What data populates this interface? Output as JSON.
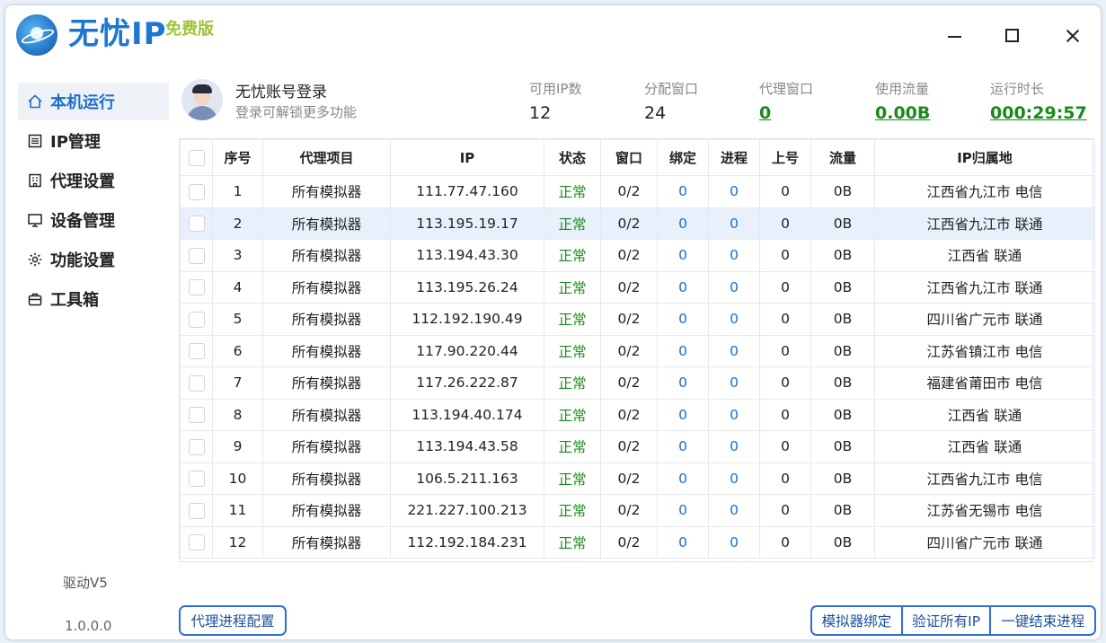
{
  "app": {
    "title": "无忧IP",
    "edition": "免费版"
  },
  "sidebar": {
    "items": [
      {
        "label": "本机运行",
        "icon": "home-icon",
        "active": true
      },
      {
        "label": "IP管理",
        "icon": "list-icon"
      },
      {
        "label": "代理设置",
        "icon": "building-icon"
      },
      {
        "label": "设备管理",
        "icon": "monitor-icon"
      },
      {
        "label": "功能设置",
        "icon": "gear-icon"
      },
      {
        "label": "工具箱",
        "icon": "toolbox-icon"
      }
    ],
    "driver": "驱动V5",
    "version": "1.0.0.0"
  },
  "user": {
    "title": "无忧账号登录",
    "subtitle": "登录可解锁更多功能"
  },
  "stats": [
    {
      "label": "可用IP数",
      "value": "12"
    },
    {
      "label": "分配窗口",
      "value": "24"
    },
    {
      "label": "代理窗口",
      "value": "0"
    },
    {
      "label": "使用流量",
      "value": "0.00B"
    },
    {
      "label": "运行时长",
      "value": "000:29:57"
    }
  ],
  "table": {
    "headers": [
      "序号",
      "代理项目",
      "IP",
      "状态",
      "窗口",
      "绑定",
      "进程",
      "上号",
      "流量",
      "IP归属地"
    ],
    "rows": [
      [
        "1",
        "所有模拟器",
        "111.77.47.160",
        "正常",
        "0/2",
        "0",
        "0",
        "0",
        "0B",
        "江西省九江市 电信"
      ],
      [
        "2",
        "所有模拟器",
        "113.195.19.17",
        "正常",
        "0/2",
        "0",
        "0",
        "0",
        "0B",
        "江西省九江市 联通"
      ],
      [
        "3",
        "所有模拟器",
        "113.194.43.30",
        "正常",
        "0/2",
        "0",
        "0",
        "0",
        "0B",
        "江西省 联通"
      ],
      [
        "4",
        "所有模拟器",
        "113.195.26.24",
        "正常",
        "0/2",
        "0",
        "0",
        "0",
        "0B",
        "江西省九江市 联通"
      ],
      [
        "5",
        "所有模拟器",
        "112.192.190.49",
        "正常",
        "0/2",
        "0",
        "0",
        "0",
        "0B",
        "四川省广元市 联通"
      ],
      [
        "6",
        "所有模拟器",
        "117.90.220.44",
        "正常",
        "0/2",
        "0",
        "0",
        "0",
        "0B",
        "江苏省镇江市 电信"
      ],
      [
        "7",
        "所有模拟器",
        "117.26.222.87",
        "正常",
        "0/2",
        "0",
        "0",
        "0",
        "0B",
        "福建省莆田市 电信"
      ],
      [
        "8",
        "所有模拟器",
        "113.194.40.174",
        "正常",
        "0/2",
        "0",
        "0",
        "0",
        "0B",
        "江西省 联通"
      ],
      [
        "9",
        "所有模拟器",
        "113.194.43.58",
        "正常",
        "0/2",
        "0",
        "0",
        "0",
        "0B",
        "江西省 联通"
      ],
      [
        "10",
        "所有模拟器",
        "106.5.211.163",
        "正常",
        "0/2",
        "0",
        "0",
        "0",
        "0B",
        "江西省九江市 电信"
      ],
      [
        "11",
        "所有模拟器",
        "221.227.100.213",
        "正常",
        "0/2",
        "0",
        "0",
        "0",
        "0B",
        "江苏省无锡市 电信"
      ],
      [
        "12",
        "所有模拟器",
        "112.192.184.231",
        "正常",
        "0/2",
        "0",
        "0",
        "0",
        "0B",
        "四川省广元市 联通"
      ]
    ],
    "selected_row": 2
  },
  "buttons": {
    "proxy_config": "代理进程配置",
    "bind_emulator": "模拟器绑定",
    "verify_all": "验证所有IP",
    "end_all": "一键结束进程"
  },
  "colors": {
    "accent": "#1d6fc9",
    "status_ok": "#1a8a1a",
    "edition": "#9dc53b"
  }
}
